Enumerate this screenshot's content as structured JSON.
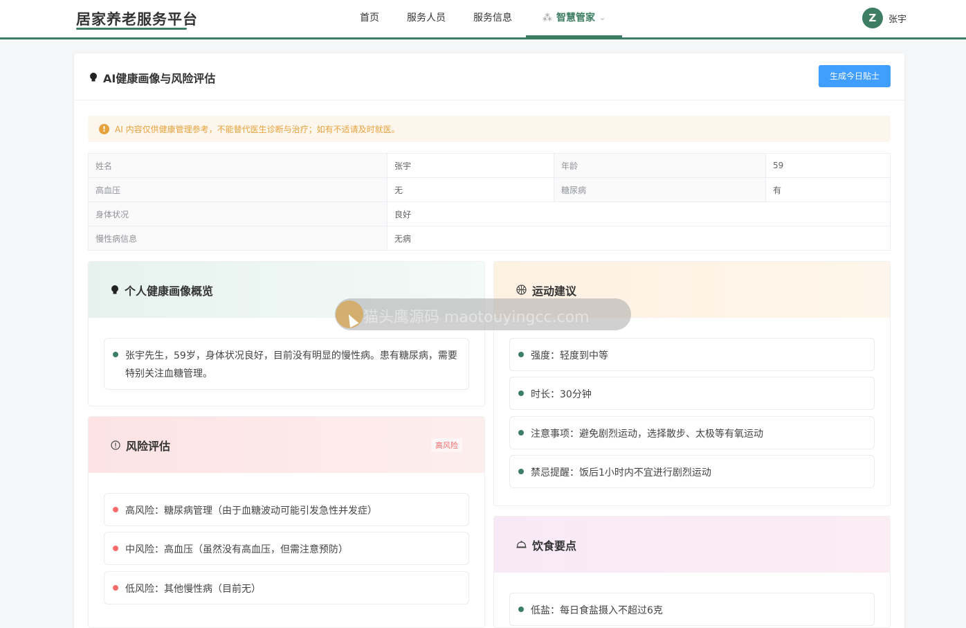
{
  "app": {
    "title": "居家养老服务平台"
  },
  "nav": {
    "items": [
      "首页",
      "服务人员",
      "服务信息"
    ],
    "active": "智慧管家"
  },
  "user": {
    "avatar_letter": "Z",
    "name": "张宇"
  },
  "card": {
    "title": "AI健康画像与风险评估",
    "generate_button": "生成今日贴士",
    "alert": "AI 内容仅供健康管理参考，不能替代医生诊断与治疗；如有不适请及时就医。"
  },
  "info": {
    "name_label": "姓名",
    "name_value": "张宇",
    "age_label": "年龄",
    "age_value": "59",
    "hypertension_label": "高血压",
    "hypertension_value": "无",
    "diabetes_label": "糖尿病",
    "diabetes_value": "有",
    "condition_label": "身体状况",
    "condition_value": "良好",
    "chronic_label": "慢性病信息",
    "chronic_value": "无病"
  },
  "profile": {
    "title": "个人健康画像概览",
    "items": [
      "张宇先生，59岁，身体状况良好，目前没有明显的慢性病。患有糖尿病，需要特别关注血糖管理。"
    ]
  },
  "risk": {
    "title": "风险评估",
    "tag": "高风险",
    "items": [
      "高风险：糖尿病管理（由于血糖波动可能引发急性并发症）",
      "中风险：高血压（虽然没有高血压，但需注意预防）",
      "低风险：其他慢性病（目前无）"
    ]
  },
  "exercise": {
    "title": "运动建议",
    "items": [
      "强度：轻度到中等",
      "时长：30分钟",
      "注意事项：避免剧烈运动，选择散步、太极等有氧运动",
      "禁忌提醒：饭后1小时内不宜进行剧烈运动"
    ]
  },
  "diet": {
    "title": "饮食要点",
    "items": [
      "低盐：每日食盐摄入不超过6克"
    ]
  },
  "watermark": {
    "text": "猫头鹰源码 maotouyingcc.com"
  },
  "colors": {
    "accent": "#3d7d63",
    "primary_button": "#409eff",
    "warning": "#e6a23c",
    "danger": "#f56c6c"
  }
}
